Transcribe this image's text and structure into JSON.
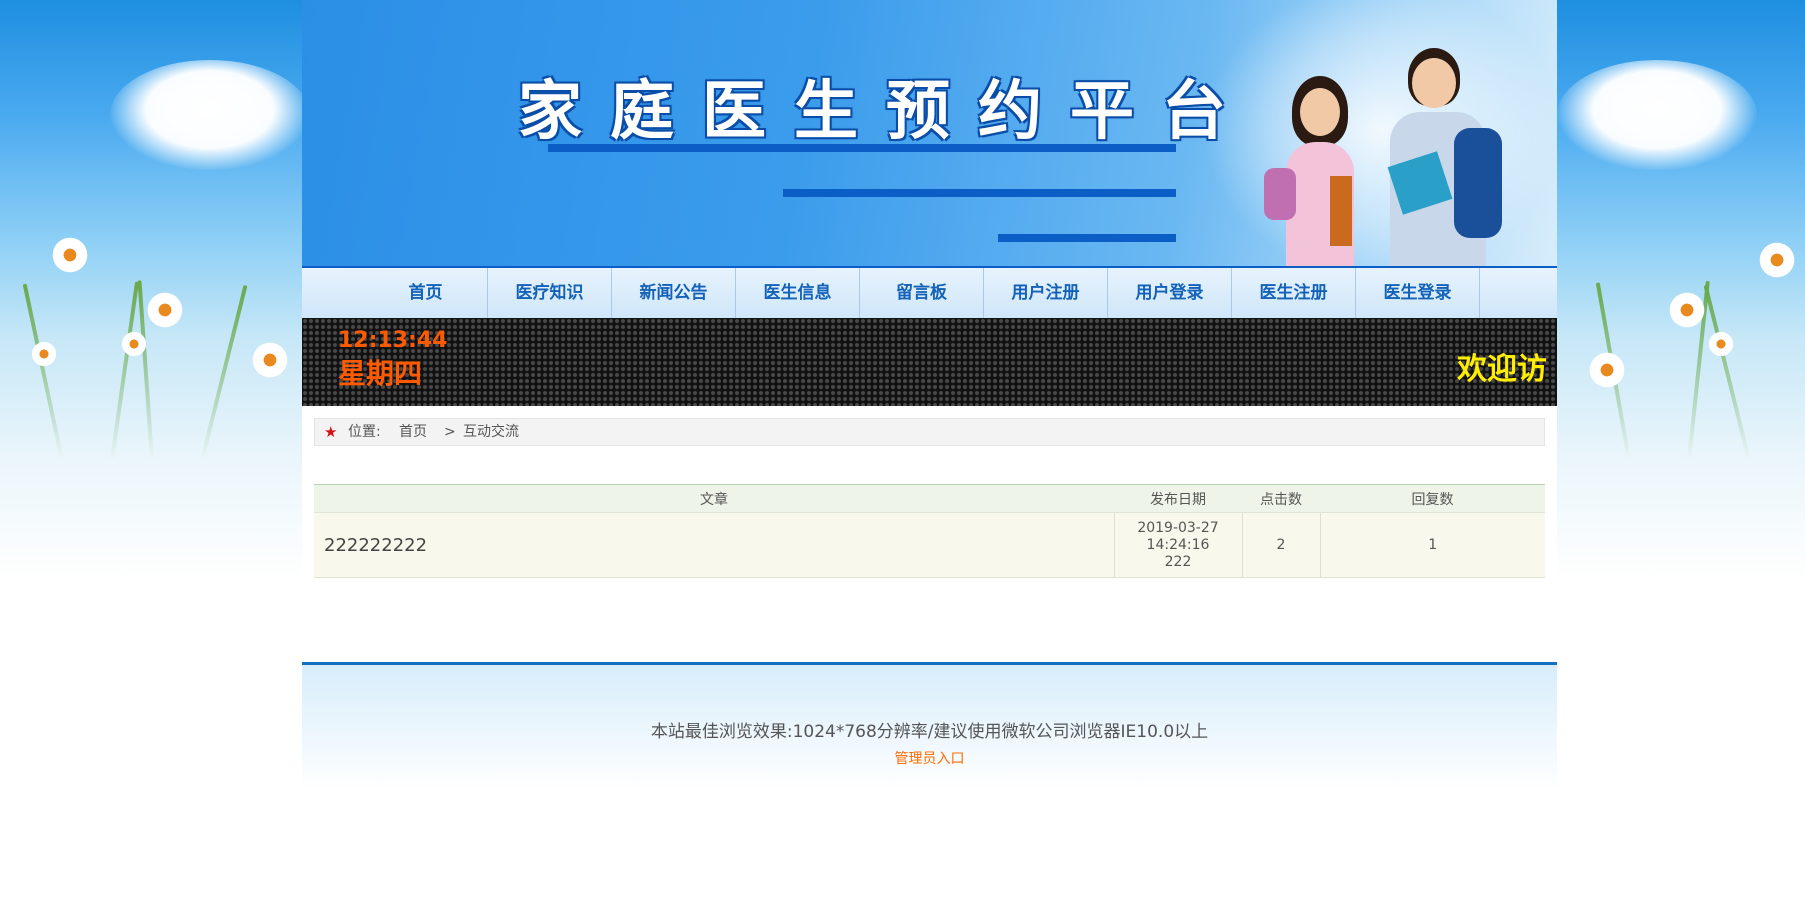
{
  "header": {
    "site_title": "家庭医生预约平台"
  },
  "nav": {
    "items": [
      {
        "label": "首页"
      },
      {
        "label": "医疗知识"
      },
      {
        "label": "新闻公告"
      },
      {
        "label": "医生信息"
      },
      {
        "label": "留言板"
      },
      {
        "label": "用户注册"
      },
      {
        "label": "用户登录"
      },
      {
        "label": "医生注册"
      },
      {
        "label": "医生登录"
      }
    ]
  },
  "ticker": {
    "time": "12:13:44",
    "weekday": "星期四",
    "marquee_text": "欢迎访"
  },
  "breadcrumb": {
    "label": "位置:",
    "home": "首页",
    "separator": ">",
    "current": "互动交流"
  },
  "table": {
    "headers": [
      "文章",
      "发布日期",
      "点击数",
      "回复数"
    ],
    "rows": [
      {
        "title": "222222222",
        "date": "2019-03-27 14:24:16",
        "author": "222",
        "clicks": "2",
        "replies": "1"
      }
    ]
  },
  "footer": {
    "note": "本站最佳浏览效果:1024*768分辨率/建议使用微软公司浏览器IE10.0以上",
    "admin_link": "管理员入口"
  },
  "colors": {
    "nav_text": "#1362b8",
    "clock": "#ff5a00",
    "marquee": "#ffee00",
    "admin_link": "#ff6a00",
    "accent_bar": "#0b5ec5"
  }
}
